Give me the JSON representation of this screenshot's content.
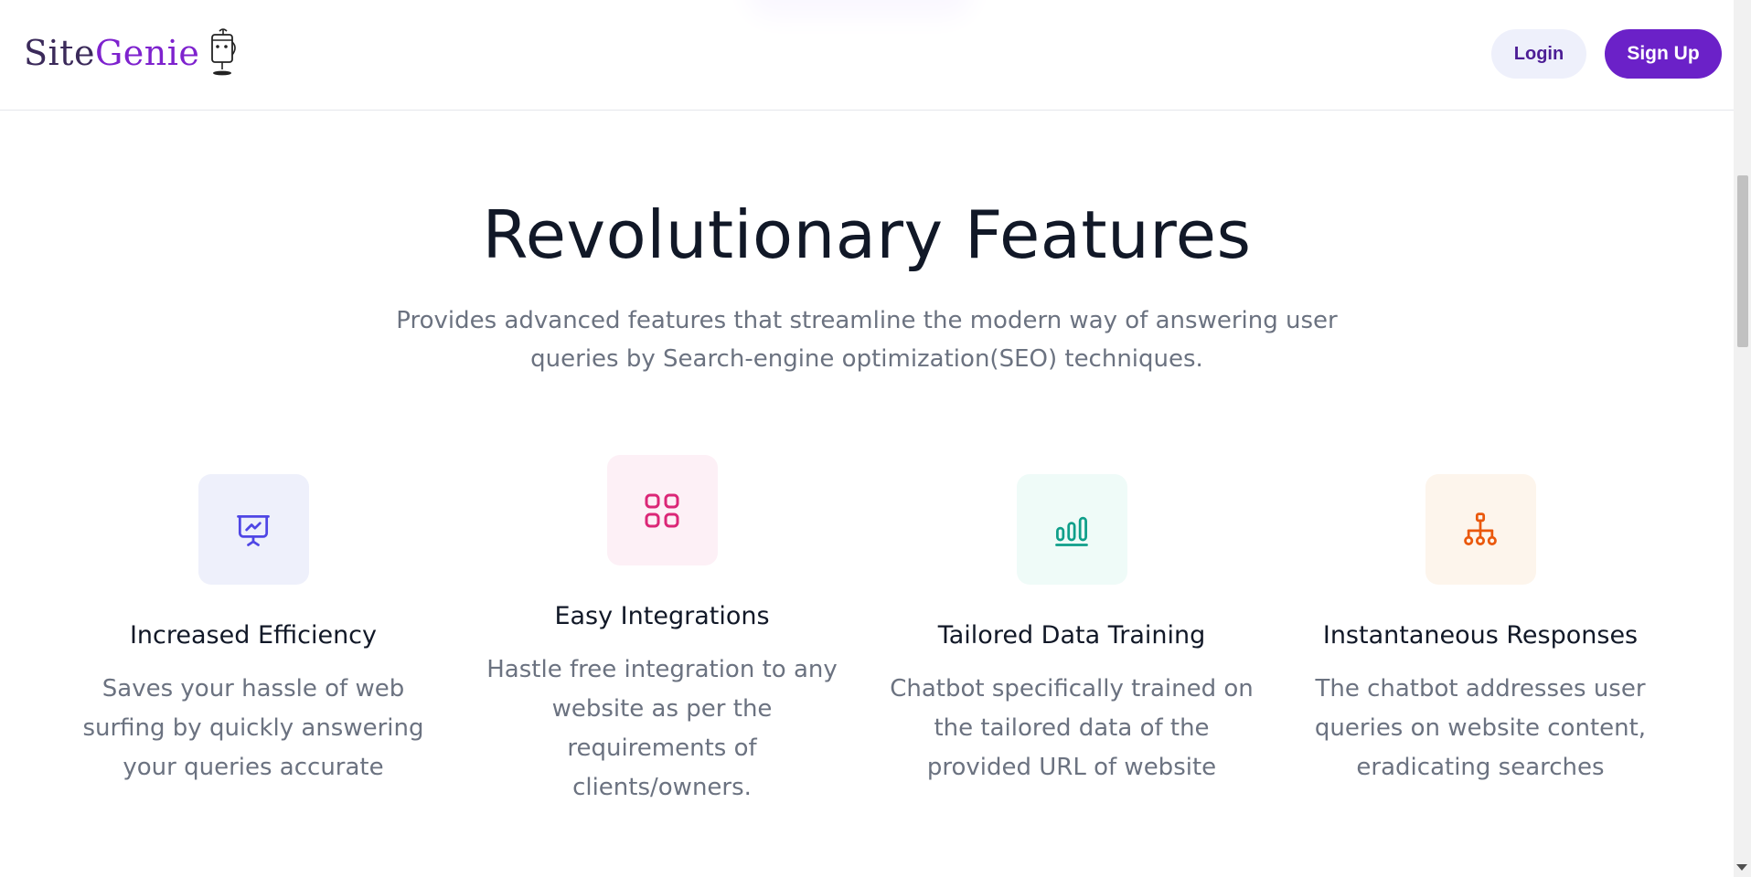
{
  "header": {
    "logo_text_1": "Site",
    "logo_text_2": "Genie",
    "login_label": "Login",
    "signup_label": "Sign Up"
  },
  "section": {
    "title": "Revolutionary Features",
    "subtitle": "Provides advanced features that streamline the modern way of answering user queries by Search-engine optimization(SEO) techniques."
  },
  "features": [
    {
      "icon": "presentation-chart-icon",
      "color": "#4f46e5",
      "title": "Increased Efficiency",
      "description": "Saves your hassle of web surfing by quickly answering your queries accurate"
    },
    {
      "icon": "apps-grid-icon",
      "color": "#db2777",
      "title": "Easy Integrations",
      "description": "Hastle free integration to any website as per the requirements of clients/owners."
    },
    {
      "icon": "bar-chart-icon",
      "color": "#0f9f8a",
      "title": "Tailored Data Training",
      "description": "Chatbot specifically trained on the tailored data of the provided URL of website"
    },
    {
      "icon": "sitemap-icon",
      "color": "#ea580c",
      "title": "Instantaneous Responses",
      "description": "The chatbot addresses user queries on website content, eradicating searches"
    }
  ],
  "colors": {
    "accent": "#6b21c8",
    "login_bg": "#eef0fb",
    "login_text": "#4c1d95"
  }
}
